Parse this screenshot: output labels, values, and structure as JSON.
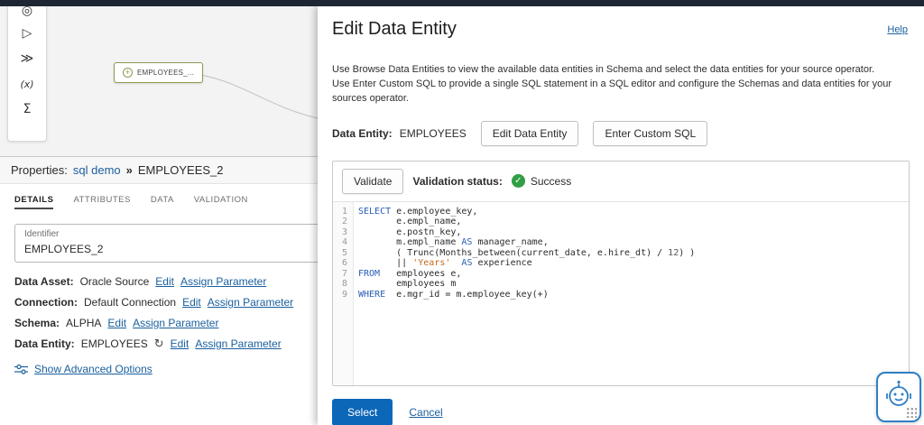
{
  "colors": {
    "accent": "#0d67b8",
    "link": "#1a5f9e",
    "success": "#2f9e44",
    "node-green": "#8a9b50",
    "sql-keyword": "#2a5db5",
    "sql-string": "#c86a1a"
  },
  "icons": {
    "plus": "+",
    "refresh": "↻",
    "check": "✓"
  },
  "canvas": {
    "node_label": "EMPLOYEES_...",
    "palette_icons": [
      {
        "name": "target",
        "glyph": "◎"
      },
      {
        "name": "run",
        "glyph": "▷"
      },
      {
        "name": "split",
        "glyph": "≫"
      },
      {
        "name": "expression",
        "glyph": "(x)"
      },
      {
        "name": "aggregate",
        "glyph": "Σ"
      }
    ]
  },
  "properties": {
    "title": "Properties:",
    "breadcrumb_flow": "sql demo",
    "breadcrumb_sep": "»",
    "breadcrumb_node": "EMPLOYEES_2",
    "tabs": [
      "DETAILS",
      "ATTRIBUTES",
      "DATA",
      "VALIDATION"
    ],
    "identifier_label": "Identifier",
    "identifier_value": "EMPLOYEES_2",
    "fields": [
      {
        "label": "Data Asset:",
        "value": "Oracle Source",
        "edit_label": "Edit",
        "assign_label": "Assign Parameter"
      },
      {
        "label": "Connection:",
        "value": "Default Connection",
        "edit_label": "Edit",
        "assign_label": "Assign Parameter"
      },
      {
        "label": "Schema:",
        "value": "ALPHA",
        "edit_label": "Edit",
        "assign_label": "Assign Parameter"
      },
      {
        "label": "Data Entity:",
        "value": "EMPLOYEES",
        "edit_label": "Edit",
        "assign_label": "Assign Parameter"
      }
    ],
    "advanced_link": "Show Advanced Options"
  },
  "drawer": {
    "title": "Edit Data Entity",
    "help_label": "Help",
    "description": [
      "Use Browse Data Entities to view the available data entities in Schema and select the data entities for your source operator.",
      "Use Enter Custom SQL to provide a single SQL statement in a SQL editor and configure the Schemas and data entities for your sources operator."
    ],
    "entity_label": "Data Entity:",
    "entity_value": "EMPLOYEES",
    "edit_entity_button": "Edit Data Entity",
    "custom_sql_button": "Enter Custom SQL",
    "validate_button": "Validate",
    "validation_label": "Validation status:",
    "validation_status": "Success",
    "select_button": "Select",
    "cancel_button": "Cancel"
  },
  "sql": {
    "lines": [
      "SELECT e.employee_key,",
      "       e.empl_name,",
      "       e.postn_key,",
      "       m.empl_name AS manager_name,",
      "       ( Trunc(Months_between(current_date, e.hire_dt) / 12) )",
      "       || 'Years'  AS experience",
      "FROM   employees e,",
      "       employees m",
      "WHERE  e.mgr_id = m.employee_key(+)"
    ]
  }
}
